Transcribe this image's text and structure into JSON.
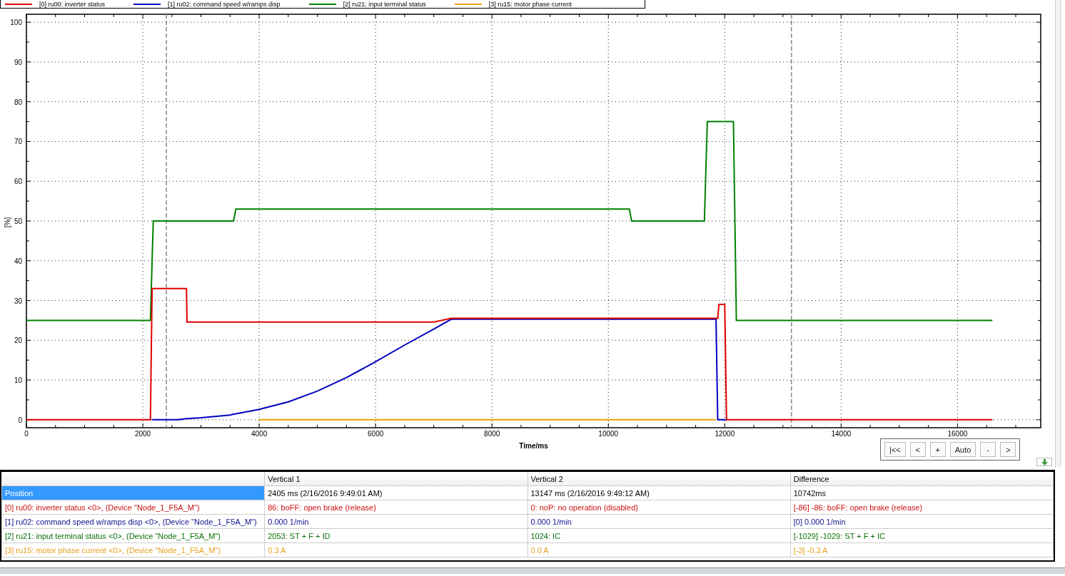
{
  "chart": {
    "chart_data": {
      "type": "line",
      "xlabel": "Time/ms",
      "ylabel": "[%]",
      "xlim": [
        0,
        17430
      ],
      "ylim": [
        -2,
        102
      ],
      "grid": true,
      "xticks": [
        0,
        2000,
        4000,
        6000,
        8000,
        10000,
        12000,
        14000,
        16000
      ],
      "yticks": [
        0,
        10,
        20,
        30,
        40,
        50,
        60,
        70,
        80,
        90,
        100
      ],
      "x": [
        0,
        2130,
        2160,
        2180,
        2600,
        2750,
        2760,
        3000,
        3500,
        3560,
        3600,
        4000,
        4500,
        5000,
        5500,
        6000,
        6500,
        7000,
        7300,
        10360,
        10400,
        11650,
        11700,
        11850,
        11880,
        11900,
        12000,
        12030,
        12150,
        12200,
        16600
      ],
      "series": [
        {
          "name": "[0] ru00: inverter status",
          "color": "#e00000",
          "values": [
            0,
            0,
            33,
            33,
            33,
            33,
            24.6,
            24.6,
            24.6,
            24.6,
            24.6,
            24.6,
            24.6,
            24.6,
            24.6,
            24.6,
            24.6,
            24.6,
            25.5,
            25.5,
            25.5,
            25.5,
            25.5,
            25.5,
            25.5,
            29,
            29,
            0,
            0,
            0,
            0
          ]
        },
        {
          "name": "[1] ru02: command speed w/ramps disp",
          "color": "#0000c0",
          "values": [
            null,
            null,
            0,
            0,
            0,
            0.3,
            0.3,
            0.5,
            1.2,
            1.4,
            1.5,
            2.6,
            4.5,
            7.2,
            10.6,
            14.6,
            18.8,
            22.8,
            25.3,
            25.3,
            25.3,
            25.3,
            25.3,
            25.3,
            0,
            0,
            0,
            0,
            null,
            null,
            null
          ]
        },
        {
          "name": "[2] ru21: input terminal status",
          "color": "#008000",
          "values": [
            25,
            25,
            40,
            50,
            50,
            50,
            50,
            50,
            50,
            50,
            53,
            53,
            53,
            53,
            53,
            53,
            53,
            53,
            53,
            53,
            50,
            50,
            75,
            75,
            75,
            75,
            75,
            75,
            75,
            25,
            25
          ]
        },
        {
          "name": "[3] ru15: motor phase current",
          "color": "#f0a000",
          "values": [
            null,
            null,
            null,
            null,
            null,
            null,
            null,
            null,
            null,
            null,
            null,
            0,
            0,
            0,
            0,
            0,
            0,
            0,
            0,
            0,
            0,
            0,
            0,
            0,
            null,
            null,
            null,
            null,
            null,
            null,
            null
          ]
        }
      ],
      "ref_lines": [
        {
          "axis": "x",
          "value": 2405
        },
        {
          "axis": "x",
          "value": 13147
        }
      ]
    }
  },
  "navigation": [
    "|<<",
    "<",
    "+",
    "Auto",
    "-",
    ">"
  ],
  "table": {
    "columns": [
      "Vertical 1",
      "Vertical 2",
      "Difference"
    ],
    "rows": [
      {
        "label": "Position",
        "vertical_1": "2405 ms (2/16/2016 9:49:01 AM)",
        "vertical_2": "13147 ms (2/16/2016 9:49:12 AM)",
        "difference": "10742ms",
        "selected": true
      },
      {
        "label": "[0] ru00: inverter status <0>, (Device \"Node_1_F5A_M\")",
        "vertical_1": "86: boFF: open brake (release)",
        "vertical_2": "0: noP: no operation (disabled)",
        "difference": "[-86] -86: boFF: open brake (release)",
        "color": "#cc1010",
        "selected": false
      },
      {
        "label": "[1] ru02: command speed w/ramps disp <0>, (Device \"Node_1_F5A_M\")",
        "vertical_1": "0.000 1/min",
        "vertical_2": "0.000 1/min",
        "difference": "[0] 0.000 1/min",
        "color": "#101090",
        "selected": false
      },
      {
        "label": "[2] ru21: input terminal status <0>, (Device \"Node_1_F5A_M\")",
        "vertical_1": "2053: ST + F + ID",
        "vertical_2": "1024: IC",
        "difference": "[-1029] -1029: ST + F + IC",
        "color": "#0a6e0a",
        "selected": false
      },
      {
        "label": "[3] ru15: motor phase current <0>, (Device \"Node_1_F5A_M\")",
        "vertical_1": "0.3 A",
        "vertical_2": "0.0 A",
        "difference": "[-3] -0.3 A",
        "color": "#e8a020",
        "selected": false
      }
    ]
  }
}
